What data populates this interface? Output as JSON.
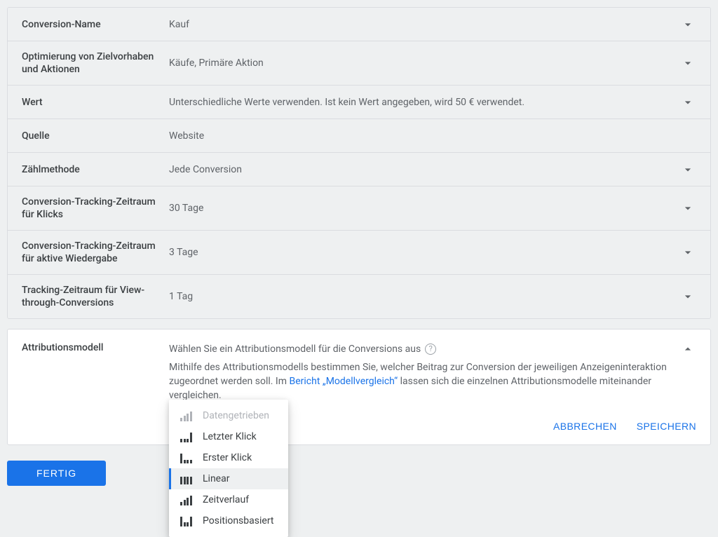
{
  "rows": [
    {
      "label": "Conversion-Name",
      "value": "Kauf",
      "expandable": true
    },
    {
      "label": "Optimierung von Zielvorhaben und Aktionen",
      "value": "Käufe, Primäre Aktion",
      "expandable": true
    },
    {
      "label": "Wert",
      "value": "Unterschiedliche Werte verwenden. Ist kein Wert angegeben, wird 50 € verwendet.",
      "expandable": true
    },
    {
      "label": "Quelle",
      "value": "Website",
      "expandable": false
    },
    {
      "label": "Zählmethode",
      "value": "Jede Conversion",
      "expandable": true
    },
    {
      "label": "Conversion-Tracking-Zeitraum für Klicks",
      "value": "30 Tage",
      "expandable": true
    },
    {
      "label": "Conversion-Tracking-Zeitraum für aktive Wiedergabe",
      "value": "3 Tage",
      "expandable": true
    },
    {
      "label": "Tracking-Zeitraum für View-through-Conversions",
      "value": "1 Tag",
      "expandable": true
    }
  ],
  "panel": {
    "label": "Attributionsmodell",
    "title": "Wählen Sie ein Attributionsmodell für die Conversions aus",
    "desc_pre": "Mithilfe des Attributionsmodells bestimmen Sie, welcher Beitrag zur Conversion der jeweiligen Anzeigeninteraktion zugeordnet werden soll. Im ",
    "desc_link": "Bericht „Modellvergleich“",
    "desc_post": " lassen sich die einzelnen Attributionsmodelle miteinander vergleichen.",
    "cancel": "ABBRECHEN",
    "save": "SPEICHERN"
  },
  "dropdown": {
    "items": [
      {
        "label": "Datengetrieben",
        "disabled": true,
        "selected": false,
        "icon": "growing"
      },
      {
        "label": "Letzter Klick",
        "disabled": false,
        "selected": false,
        "icon": "last"
      },
      {
        "label": "Erster Klick",
        "disabled": false,
        "selected": false,
        "icon": "first"
      },
      {
        "label": "Linear",
        "disabled": false,
        "selected": true,
        "icon": "flat"
      },
      {
        "label": "Zeitverlauf",
        "disabled": false,
        "selected": false,
        "icon": "growing"
      },
      {
        "label": "Positionsbasiert",
        "disabled": false,
        "selected": false,
        "icon": "position"
      }
    ]
  },
  "done": "FERTIG"
}
